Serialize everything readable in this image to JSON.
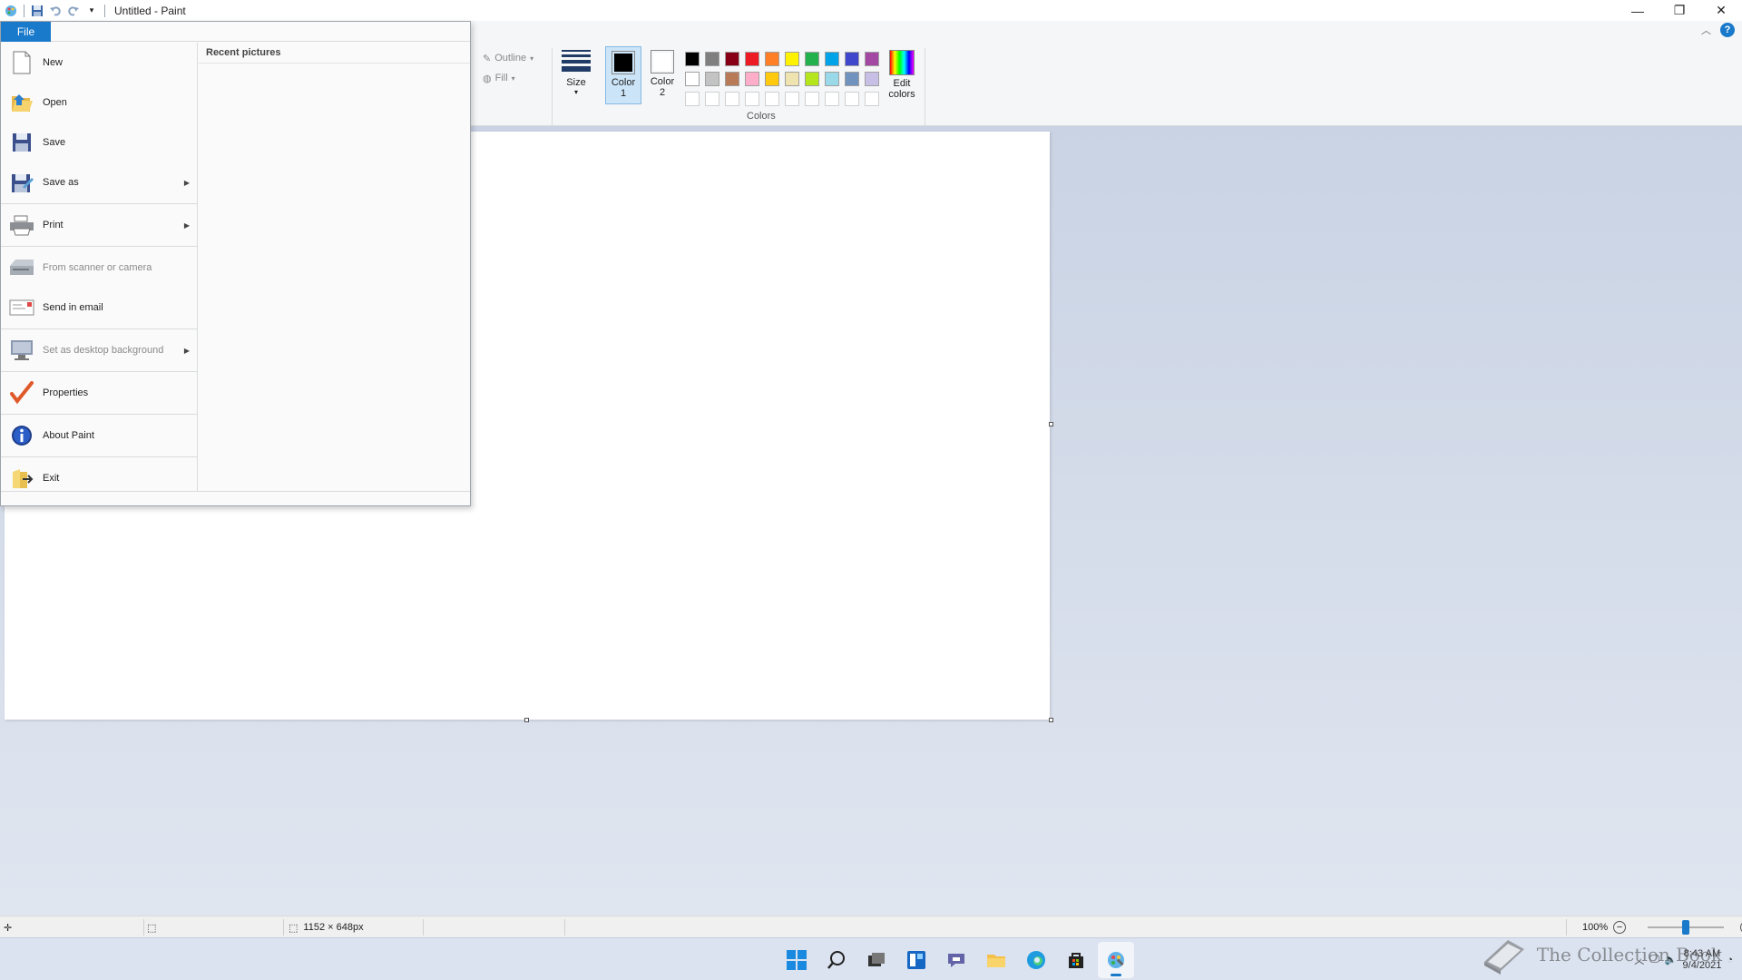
{
  "window": {
    "title": "Untitled - Paint",
    "controls": [
      "minimize",
      "restore",
      "close"
    ]
  },
  "ribbon": {
    "shape_options": {
      "outline": "Outline",
      "fill": "Fill"
    },
    "size_label": "Size",
    "color1": {
      "label_top": "Color",
      "label_bottom": "1",
      "value": "#000000"
    },
    "color2": {
      "label_top": "Color",
      "label_bottom": "2",
      "value": "#ffffff"
    },
    "palette": [
      "#000000",
      "#7f7f7f",
      "#880015",
      "#ed1c24",
      "#ff7f27",
      "#fff200",
      "#22b14c",
      "#00a2e8",
      "#3f48cc",
      "#a349a4",
      "#ffffff",
      "#c3c3c3",
      "#b97a57",
      "#ffaec9",
      "#ffc90e",
      "#efe4b0",
      "#b5e61d",
      "#99d9ea",
      "#7092be",
      "#c8bfe7",
      "#ffffff",
      "#ffffff",
      "#ffffff",
      "#ffffff",
      "#ffffff",
      "#ffffff",
      "#ffffff",
      "#ffffff",
      "#ffffff",
      "#ffffff"
    ],
    "edit_colors": {
      "line1": "Edit",
      "line2": "colors"
    },
    "colors_group_label": "Colors"
  },
  "file_menu": {
    "tab_label": "File",
    "items": [
      {
        "label": "New",
        "icon": "new-file-icon",
        "disabled": false,
        "submenu": false
      },
      {
        "label": "Open",
        "icon": "open-folder-icon",
        "disabled": false,
        "submenu": false
      },
      {
        "label": "Save",
        "icon": "save-disk-icon",
        "disabled": false,
        "submenu": false
      },
      {
        "label": "Save as",
        "icon": "save-as-icon",
        "disabled": false,
        "submenu": true
      },
      {
        "label": "Print",
        "icon": "printer-icon",
        "disabled": false,
        "submenu": true
      },
      {
        "label": "From scanner or camera",
        "icon": "scanner-icon",
        "disabled": true,
        "submenu": false
      },
      {
        "label": "Send in email",
        "icon": "email-icon",
        "disabled": false,
        "submenu": false
      },
      {
        "label": "Set as desktop background",
        "icon": "desktop-background-icon",
        "disabled": true,
        "submenu": true
      },
      {
        "label": "Properties",
        "icon": "checkmark-icon",
        "disabled": false,
        "submenu": false
      },
      {
        "label": "About Paint",
        "icon": "info-icon",
        "disabled": false,
        "submenu": false
      },
      {
        "label": "Exit",
        "icon": "exit-icon",
        "disabled": false,
        "submenu": false
      }
    ],
    "recent_title": "Recent pictures"
  },
  "statusbar": {
    "image_size": "1152 × 648px",
    "zoom": "100%",
    "zoom_level_fraction": 0.5
  },
  "taskbar": {
    "apps": [
      "start-icon",
      "search-icon",
      "task-view-icon",
      "widgets-icon",
      "chat-icon",
      "file-explorer-icon",
      "edge-icon",
      "store-icon",
      "paint-icon"
    ],
    "time": "8:43 AM",
    "date": "9/4/2021"
  },
  "watermark": "The Collection Book"
}
